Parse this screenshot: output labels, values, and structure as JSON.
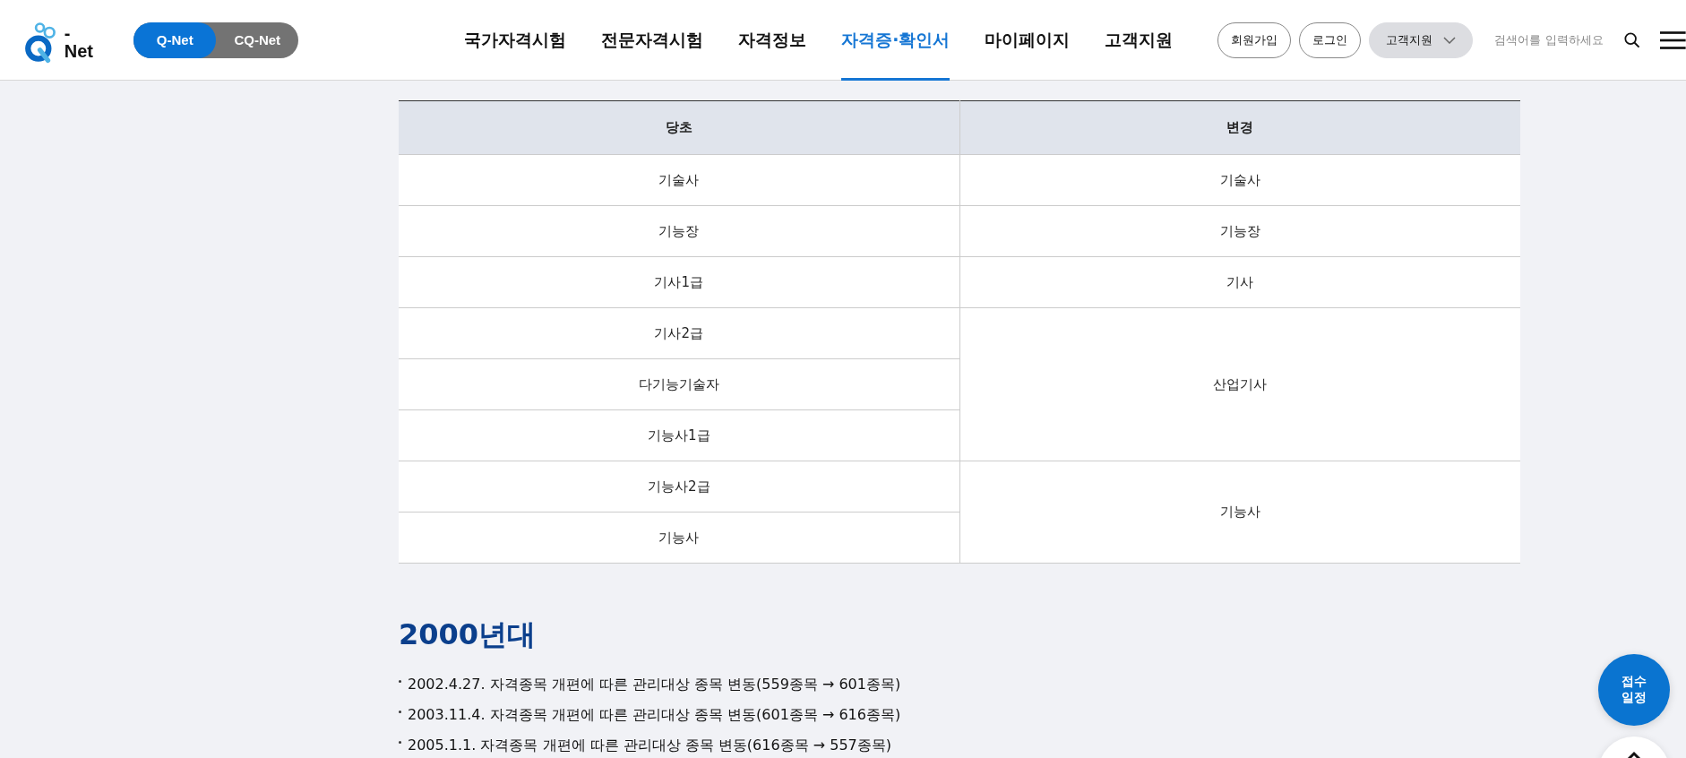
{
  "logo": {
    "text": "- Net"
  },
  "site_switch": [
    {
      "label": "Q-Net",
      "selected": true
    },
    {
      "label": "CQ-Net",
      "selected": false
    }
  ],
  "nav": [
    {
      "label": "국가자격시험",
      "selected": false
    },
    {
      "label": "전문자격시험",
      "selected": false
    },
    {
      "label": "자격정보",
      "selected": false
    },
    {
      "label": "자격증·확인서",
      "selected": true
    },
    {
      "label": "마이페이지",
      "selected": false
    },
    {
      "label": "고객지원",
      "selected": false
    }
  ],
  "header_buttons": [
    {
      "label": "회원가입",
      "kind": "outline"
    },
    {
      "label": "로그인",
      "kind": "outline"
    },
    {
      "label": "고객지원",
      "kind": "dropdown"
    }
  ],
  "search": {
    "placeholder": "검색어를 입력하세요"
  },
  "table": {
    "columns": [
      "당초",
      "변경"
    ],
    "groups": [
      {
        "changed": "기술사",
        "original": [
          "기술사"
        ]
      },
      {
        "changed": "기능장",
        "original": [
          "기능장"
        ]
      },
      {
        "changed": "기사",
        "original": [
          "기사1급"
        ]
      },
      {
        "changed": "산업기사",
        "original": [
          "기사2급",
          "다기능기술자",
          "기능사1급"
        ]
      },
      {
        "changed": "기능사",
        "original": [
          "기능사2급",
          "기능사"
        ]
      }
    ]
  },
  "section": {
    "title": "2000년대",
    "items": [
      "2002.4.27. 자격종목 개편에 따른 관리대상 종목 변동(559종목 → 601종목)",
      "2003.11.4. 자격종목 개편에 따른 관리대상 종목 변동(601종목 → 616종목)",
      "2005.1.1. 자격종목 개편에 따른 관리대상 종목 변동(616종목 → 557종목)"
    ]
  },
  "float_button": {
    "lines": [
      "접수",
      "일정"
    ]
  }
}
